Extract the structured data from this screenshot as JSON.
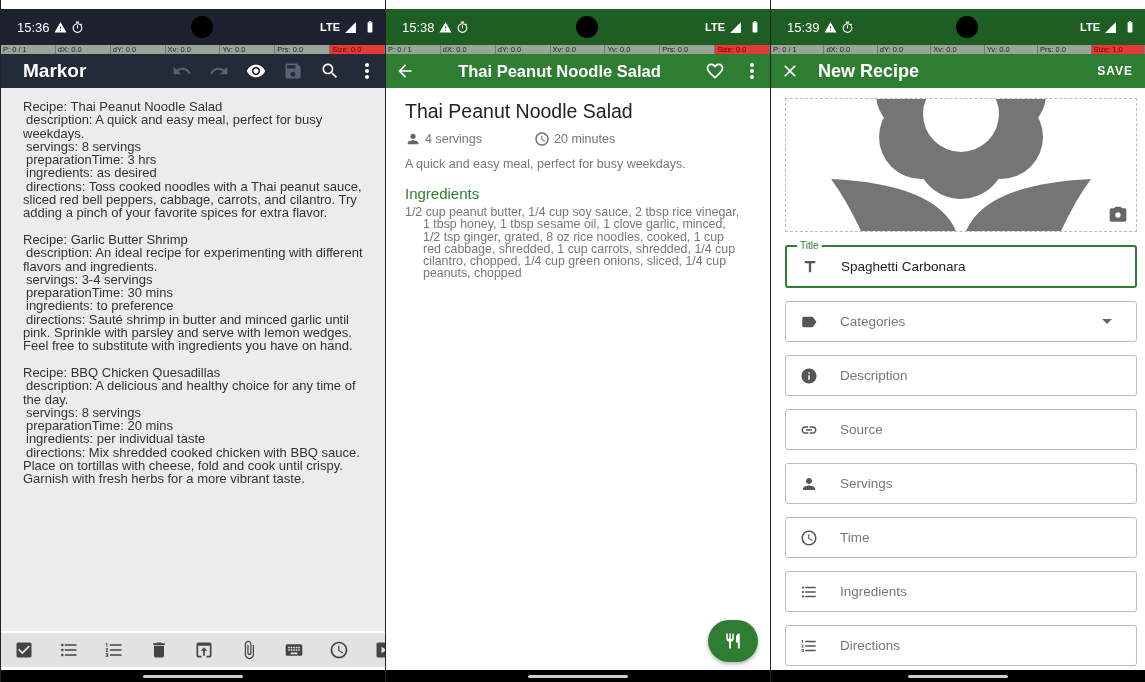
{
  "screens": [
    {
      "kind": "editor",
      "status": {
        "time": "15:36",
        "network": "LTE"
      },
      "debug": [
        "P: 0 / 1",
        "dX: 0.0",
        "dY: 0.0",
        "Xv: 0.0",
        "Yv: 0.0",
        "Prs: 0.0",
        "Size: 0.0"
      ],
      "toolbar": {
        "title": "Markor",
        "actions": [
          {
            "kind": "undo",
            "disabled": true
          },
          {
            "kind": "redo",
            "disabled": true
          },
          {
            "kind": "preview",
            "disabled": false
          },
          {
            "kind": "save",
            "disabled": true
          },
          {
            "kind": "search",
            "disabled": false
          },
          {
            "kind": "more",
            "disabled": false
          }
        ]
      },
      "document": [
        {
          "lines": [
            "Recipe: Thai Peanut Noodle Salad",
            "description: A quick and easy meal, perfect for busy weekdays.",
            "servings: 8 servings",
            "preparationTime: 3 hrs",
            "ingredients: as desired",
            "directions: Toss cooked noodles with a Thai peanut sauce, sliced red bell peppers, cabbage, carrots, and cilantro. Try adding a pinch of your favorite spices for extra flavor."
          ]
        },
        {
          "lines": [
            "Recipe: Garlic Butter Shrimp",
            "description: An ideal recipe for experimenting with different flavors and ingredients.",
            "servings: 3-4 servings",
            "preparationTime: 30 mins",
            "ingredients: to preference",
            "directions: Sauté shrimp in butter and minced garlic until pink. Sprinkle with parsley and serve with lemon wedges. Feel free to substitute with ingredients you have on hand."
          ]
        },
        {
          "lines": [
            "Recipe: BBQ Chicken Quesadillas",
            "description: A delicious and healthy choice for any time of the day.",
            "servings: 8 servings",
            "preparationTime: 20 mins",
            "ingredients: per individual taste",
            "directions: Mix shredded cooked chicken with BBQ sauce. Place on tortillas with cheese, fold and cook until crispy. Garnish with fresh herbs for a more vibrant taste."
          ]
        }
      ],
      "bottom_toolbar": [
        {
          "kind": "checkbox"
        },
        {
          "kind": "bullets"
        },
        {
          "kind": "numbers"
        },
        {
          "kind": "delete"
        },
        {
          "kind": "upload"
        },
        {
          "kind": "attach"
        },
        {
          "kind": "keyboard"
        },
        {
          "kind": "clock"
        },
        {
          "kind": "play"
        }
      ]
    },
    {
      "kind": "recipe",
      "status": {
        "time": "15:38",
        "network": "LTE"
      },
      "debug": [
        "P: 0 / 1",
        "dX: 0.0",
        "dY: 0.0",
        "Xv: 0.0",
        "Yv: 0.0",
        "Prs: 0.0",
        "Size: 0.0"
      ],
      "toolbar": {
        "title": "Thai Peanut Noodle Salad",
        "favorite": false
      },
      "recipe": {
        "name": "Thai Peanut Noodle Salad",
        "servings": "4 servings",
        "time": "20 minutes",
        "description": "A quick and easy meal, perfect for busy weekdays.",
        "section": "Ingredients",
        "ingredients": "1/2 cup peanut butter, 1/4 cup soy sauce, 2 tbsp rice vinegar, 1 tbsp honey, 1 tbsp sesame oil, 1 clove garlic, minced, 1/2 tsp ginger, grated, 8 oz rice noodles, cooked, 1 cup red cabbage, shredded, 1 cup carrots, shredded, 1/4 cup cilantro, chopped, 1/4 cup green onions, sliced, 1/4 cup peanuts, chopped"
      }
    },
    {
      "kind": "form",
      "status": {
        "time": "15:39",
        "network": "LTE"
      },
      "debug": [
        "P: 0 / 1",
        "dX: 0.0",
        "dY: 0.0",
        "Xv: 0.0",
        "Yv: 0.0",
        "Prs: 0.0",
        "Size: 1.0"
      ],
      "toolbar": {
        "title": "New Recipe",
        "action": "SAVE"
      },
      "fields": [
        {
          "kind": "title",
          "label": "Title",
          "value": "Spaghetti Carbonara",
          "focused": true
        },
        {
          "kind": "categories",
          "placeholder": "Categories",
          "focused": false
        },
        {
          "kind": "description",
          "placeholder": "Description",
          "focused": false
        },
        {
          "kind": "source",
          "placeholder": "Source",
          "focused": false
        },
        {
          "kind": "servings",
          "placeholder": "Servings",
          "focused": false
        },
        {
          "kind": "time",
          "placeholder": "Time",
          "focused": false
        },
        {
          "kind": "ingredients",
          "placeholder": "Ingredients",
          "focused": false
        },
        {
          "kind": "directions",
          "placeholder": "Directions",
          "focused": false
        }
      ]
    }
  ]
}
